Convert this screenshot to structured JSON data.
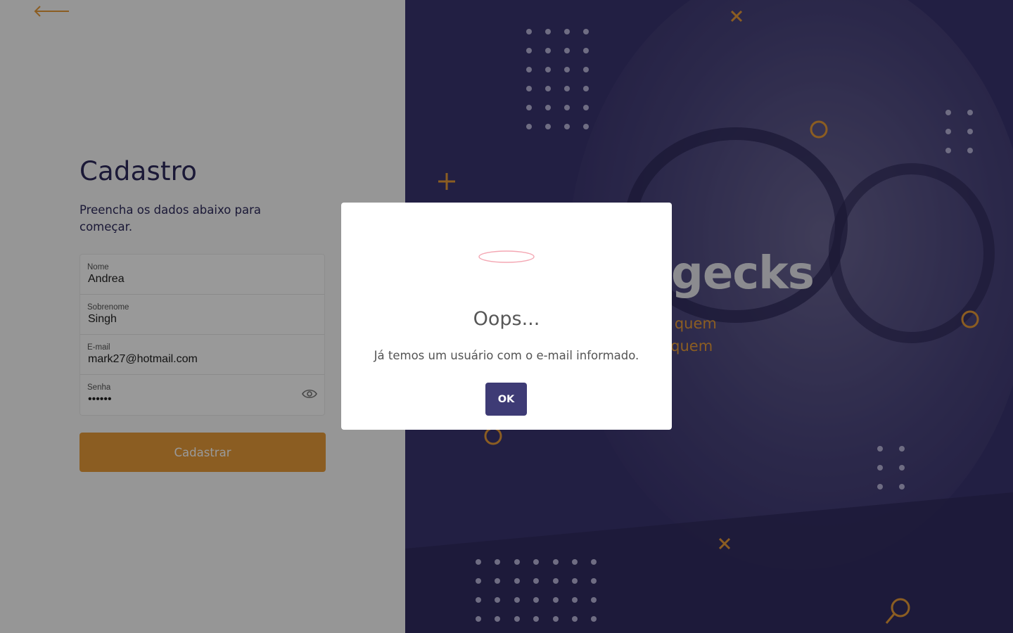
{
  "form": {
    "title": "Cadastro",
    "subtitle": "Preencha os dados abaixo para começar.",
    "fields": [
      {
        "label": "Nome",
        "value": "Andrea"
      },
      {
        "label": "Sobrenome",
        "value": "Singh"
      },
      {
        "label": "E-mail",
        "value": "mark27@hotmail.com"
      },
      {
        "label": "Senha",
        "value": "••••••"
      }
    ],
    "submit_label": "Cadastrar"
  },
  "brand": {
    "wordmark": "gecks",
    "tagline_1": "do quem",
    "tagline_2": "m quem"
  },
  "modal": {
    "title": "Oops...",
    "message": "Já temos um usuário com o e-mail informado.",
    "ok_label": "OK"
  },
  "colors": {
    "accent": "#e89c3a",
    "primary": "#3e3b75",
    "brand_bg": "#3a3470"
  },
  "icons": [
    "back-arrow-icon",
    "eye-icon",
    "error-icon"
  ]
}
